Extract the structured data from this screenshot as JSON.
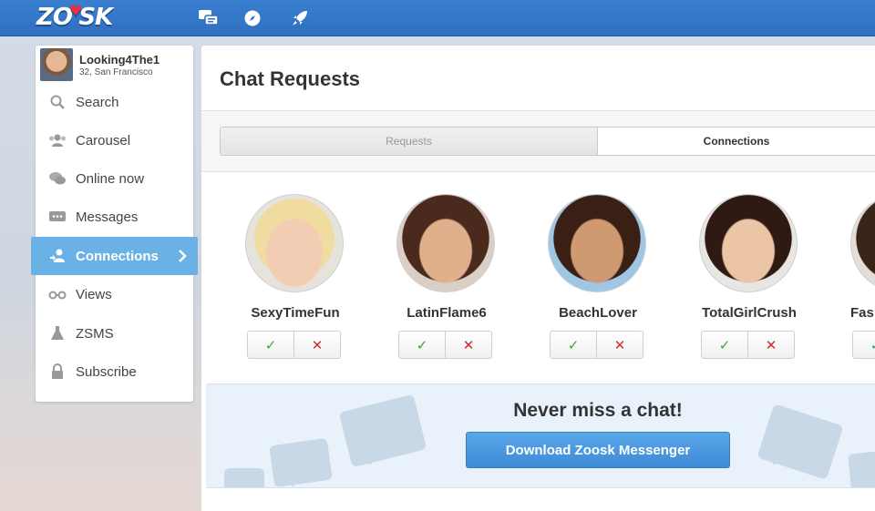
{
  "app": {
    "logo_text": "ZOOSK",
    "brand_color": "#2f6fc0"
  },
  "topbar": {
    "icons": [
      "chat-bubbles-icon",
      "compass-icon",
      "rocket-icon"
    ]
  },
  "profile": {
    "name": "Looking4The1",
    "meta": "32, San Francisco"
  },
  "sidebar": {
    "items": [
      {
        "label": "Search",
        "icon": "search-icon",
        "active": false
      },
      {
        "label": "Carousel",
        "icon": "carousel-icon",
        "active": false
      },
      {
        "label": "Online now",
        "icon": "online-chat-icon",
        "active": false
      },
      {
        "label": "Messages",
        "icon": "messages-icon",
        "active": false
      },
      {
        "label": "Connections",
        "icon": "connections-icon",
        "active": true
      },
      {
        "label": "Views",
        "icon": "views-glasses-icon",
        "active": false
      },
      {
        "label": "ZSMS",
        "icon": "flask-icon",
        "active": false
      },
      {
        "label": "Subscribe",
        "icon": "lock-icon",
        "active": false
      }
    ],
    "active_color": "#6ab2e6"
  },
  "main": {
    "title": "Chat Requests",
    "tabs": [
      {
        "label": "Requests",
        "selected": false
      },
      {
        "label": "Connections",
        "selected": true
      }
    ],
    "users": [
      {
        "name": "SexyTimeFun",
        "accept": "✓",
        "decline": "✕"
      },
      {
        "name": "LatinFlame6",
        "accept": "✓",
        "decline": "✕"
      },
      {
        "name": "BeachLover",
        "accept": "✓",
        "decline": "✕"
      },
      {
        "name": "TotalGirlCrush",
        "accept": "✓",
        "decline": "✕"
      },
      {
        "name": "Fas",
        "accept": "✓",
        "decline": "✕"
      }
    ],
    "promo": {
      "title": "Never miss a chat!",
      "button_label": "Download Zoosk Messenger"
    }
  }
}
